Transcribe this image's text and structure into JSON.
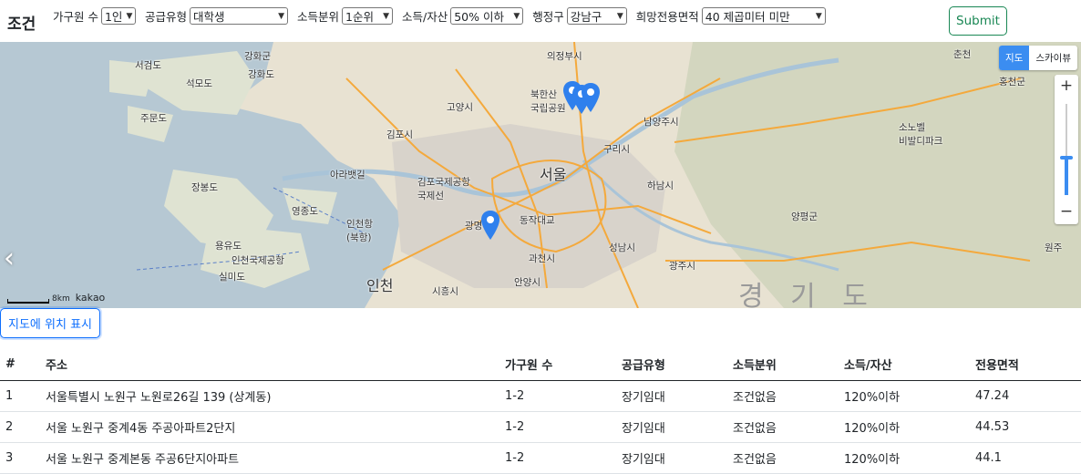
{
  "header": {
    "title": "조건"
  },
  "filters": [
    {
      "label": "가구원 수",
      "value": "1인"
    },
    {
      "label": "공급유형",
      "value": "대학생"
    },
    {
      "label": "소득분위",
      "value": "1순위"
    },
    {
      "label": "소득/자산",
      "value": "50% 이하"
    },
    {
      "label": "행정구",
      "value": "강남구"
    },
    {
      "label": "희망전용면적",
      "value": "40 제곱미터 미만"
    }
  ],
  "submit_label": "Submit",
  "map": {
    "type_buttons": [
      "지도",
      "스카이뷰"
    ],
    "zoom_in": "+",
    "zoom_out": "−",
    "scale_text": "8km",
    "logo": "kakao",
    "labels": {
      "seoul": "서울",
      "incheon": "인천",
      "gyeonggi": "경 기 도",
      "gimpo": "김포시",
      "goyang": "고양시",
      "uijeongbu": "의정부시",
      "namyangju": "남양주시",
      "guri": "구리시",
      "hanam": "하남시",
      "gwangmyeong": "광명",
      "gwacheon": "과천시",
      "seongnam": "성남시",
      "gwangju": "광주시",
      "siheung": "시흥시",
      "anyang": "안양시",
      "yangpyeong": "양평군",
      "ganghwa": "강화군",
      "ganghwa2": "강화도",
      "seokmo": "석모도",
      "jumundo": "주문도",
      "seogeomdo": "서검도",
      "jangbongdo": "장봉도",
      "yeongjongdo": "영종도",
      "yongyudo": "용유도",
      "silmido": "실미도",
      "airport_incheon": "인천국제공항",
      "airport_gimpo": "김포국제공항\n국제선",
      "hongcheon": "홍천군",
      "bukhansan": "북한산\n국립공원",
      "vivaldi": "소노벨\n비발디파크",
      "incheon_port": "인천항\n(북항)",
      "dongjak": "동작대교",
      "yeongjong_bridge": "영종대교",
      "wonju": "원주",
      "arasseo": "아라뱃길",
      "chuncheon": "춘천"
    }
  },
  "show_location_label": "지도에 위치 표시",
  "table": {
    "headers": [
      "#",
      "주소",
      "가구원 수",
      "공급유형",
      "소득분위",
      "소득/자산",
      "전용면적"
    ],
    "rows": [
      [
        "1",
        "서울특별시 노원구 노원로26길 139 (상계동)",
        "1-2",
        "장기임대",
        "조건없음",
        "120%이하",
        "47.24"
      ],
      [
        "2",
        "서울 노원구 중계4동 주공아파트2단지",
        "1-2",
        "장기임대",
        "조건없음",
        "120%이하",
        "44.53"
      ],
      [
        "3",
        "서울 노원구 중계본동 주공6단지아파트",
        "1-2",
        "장기임대",
        "조건없음",
        "120%이하",
        "44.1"
      ]
    ]
  },
  "colors": {
    "primary": "#0d6efd",
    "success": "#198754",
    "map_pin": "#2f80ed",
    "map_tab_active": "#3b8df1"
  }
}
